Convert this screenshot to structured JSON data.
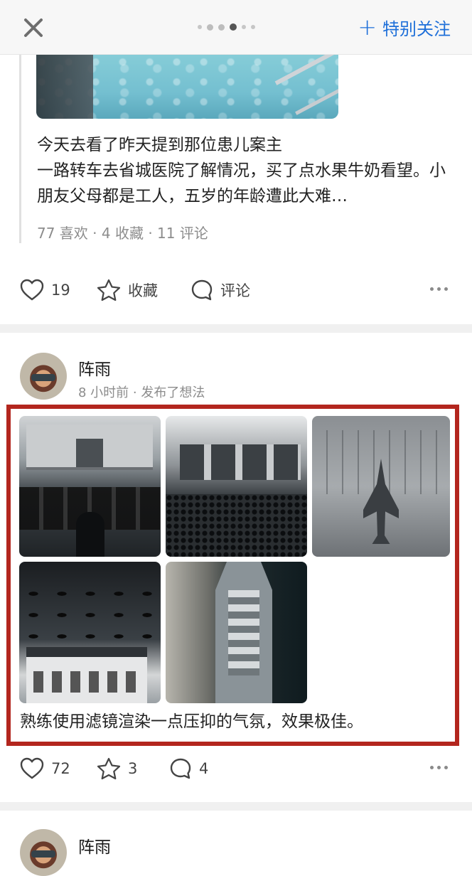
{
  "topbar": {
    "follow_label": "特别关注",
    "page_dots_count": 6,
    "active_dot_index": 4
  },
  "post1": {
    "text_line1": "今天去看了昨天提到那位患儿案主",
    "text_line2": "一路转车去省城医院了解情况，买了点水果牛奶看望。小朋友父母都是工人，五岁的年龄遭此大难…",
    "meta": "77 喜欢 · 4 收藏 · 11 评论",
    "actions": {
      "like_count": "19",
      "collect_label": "收藏",
      "comment_label": "评论"
    }
  },
  "post2": {
    "author": "阵雨",
    "subline": "8 小时前 · 发布了想法",
    "images": [
      {
        "desc_icon": "government-building-image"
      },
      {
        "desc_icon": "military-parade-image"
      },
      {
        "desc_icon": "fighter-jet-image"
      },
      {
        "desc_icon": "helicopters-over-house-image"
      },
      {
        "desc_icon": "aircraft-carrier-image"
      }
    ],
    "caption": "熟练使用滤镜渲染一点压抑的气氛，效果极佳。",
    "actions": {
      "like_count": "72",
      "star_count": "3",
      "comment_count": "4"
    }
  },
  "post3": {
    "author": "阵雨"
  },
  "colors": {
    "accent": "#1e6fd9",
    "highlight_border": "#b3261e",
    "divider": "#f0f0f0"
  }
}
